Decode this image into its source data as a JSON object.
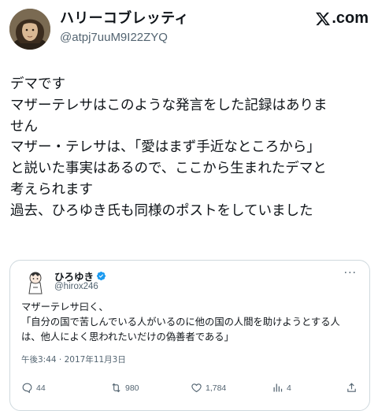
{
  "post": {
    "author_name": "ハリーコブレッティ",
    "author_handle": "@atpj7uuM9I22ZYQ",
    "brand_text": ".com",
    "brand_icon": "x-logo-icon",
    "text": "デマです\nマザーテレサはこのような発言をした記録はありま\nせん\nマザー・テレサは、「愛はまず手近なところから」\nと説いた事実はあるので、ここから生まれたデマと\n考えられます\n過去、ひろゆき氏も同様のポストをしていました"
  },
  "quoted": {
    "author_name": "ひろゆき",
    "verified_icon": "verified-badge-icon",
    "author_handle": "@hirox246",
    "more_icon": "more-options-icon",
    "text": "マザーテレサ曰く、\n「自分の国で苦しんでいる人がいるのに他の国の人間を助けようとする人\nは、他人によく思われたいだけの偽善者である」",
    "timestamp": "午後3:44 · 2017年11月3日",
    "actions": {
      "reply_count": "44",
      "repost_count": "980",
      "like_count": "1,784",
      "views_count": "4"
    }
  },
  "colors": {
    "text": "#0f1419",
    "secondary": "#536471",
    "border": "#cfd9de",
    "verified": "#1d9bf0"
  }
}
